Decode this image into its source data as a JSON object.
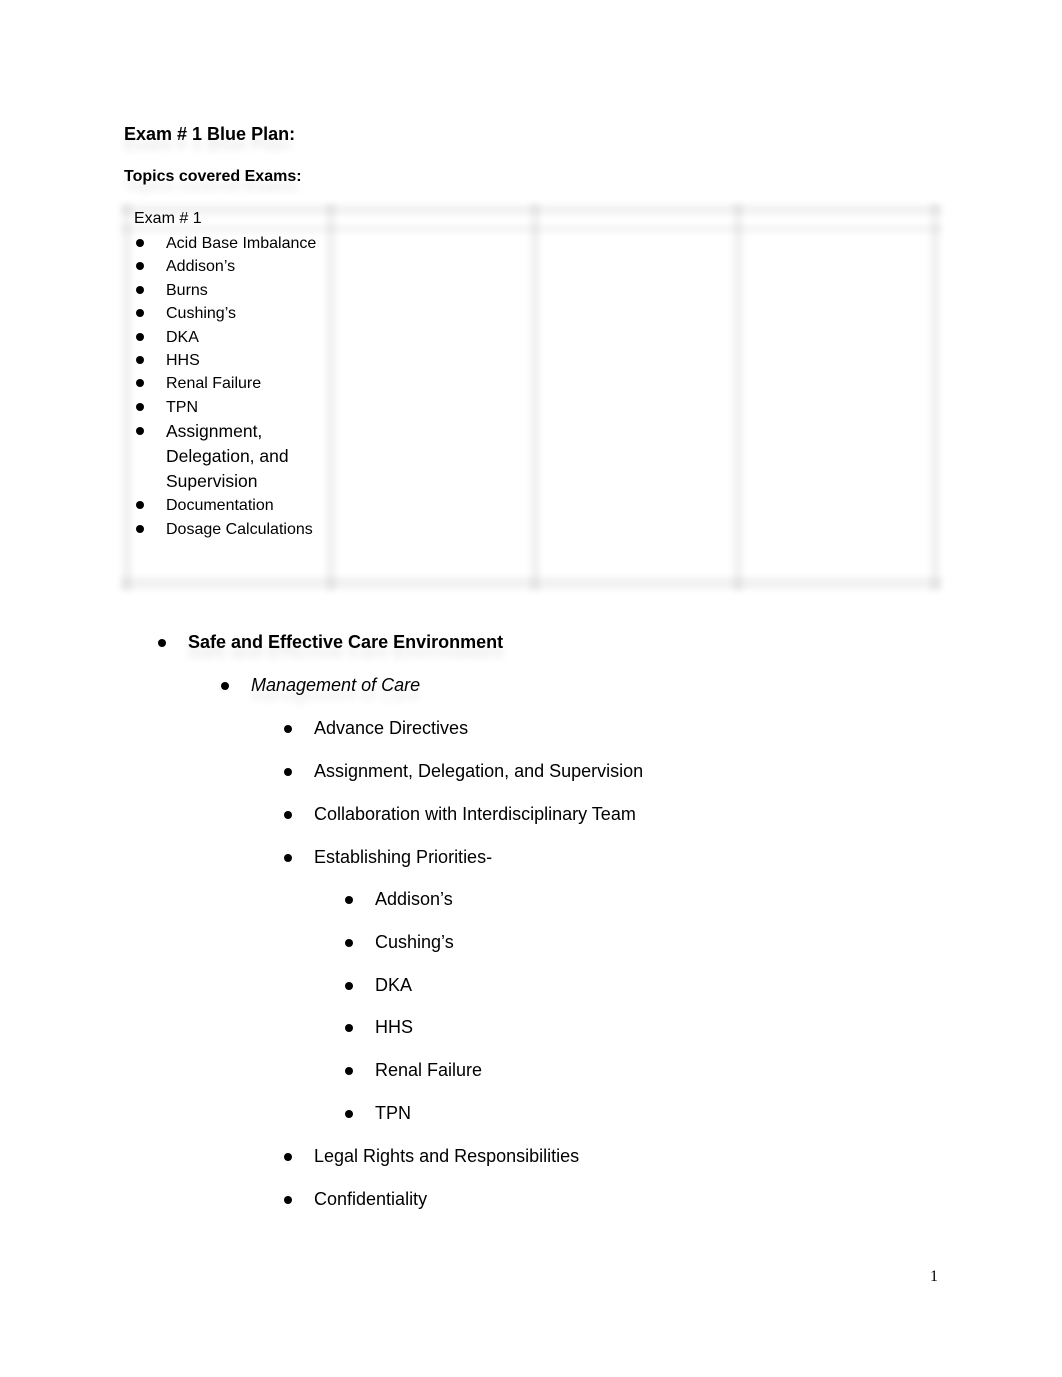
{
  "document": {
    "title": "Exam # 1 Blue Plan:",
    "subtitle": "Topics covered Exams:",
    "table": {
      "columns": 4,
      "cells": [
        {
          "heading": "Exam # 1",
          "items": [
            "Acid Base Imbalance",
            "Addison’s",
            "Burns",
            "Cushing’s",
            "DKA",
            "HHS",
            "Renal Failure",
            "TPN",
            "Assignment, Delegation, and Supervision",
            "Documentation",
            "Dosage Calculations"
          ]
        },
        {
          "heading": "",
          "items": []
        },
        {
          "heading": "",
          "items": []
        },
        {
          "heading": "",
          "items": []
        }
      ]
    },
    "outline": {
      "category": "Safe and Effective Care Environment",
      "subcategory": "Management of Care",
      "topics_before": [
        "Advance Directives",
        "Assignment, Delegation, and Supervision",
        "Collaboration with Interdisciplinary Team",
        "Establishing Priorities-"
      ],
      "priorities": [
        "Addison’s",
        "Cushing’s",
        "DKA",
        "HHS",
        "Renal Failure",
        "TPN"
      ],
      "topics_after": [
        "Legal Rights and Responsibilities",
        "Confidentiality"
      ]
    },
    "page_number": "1"
  }
}
